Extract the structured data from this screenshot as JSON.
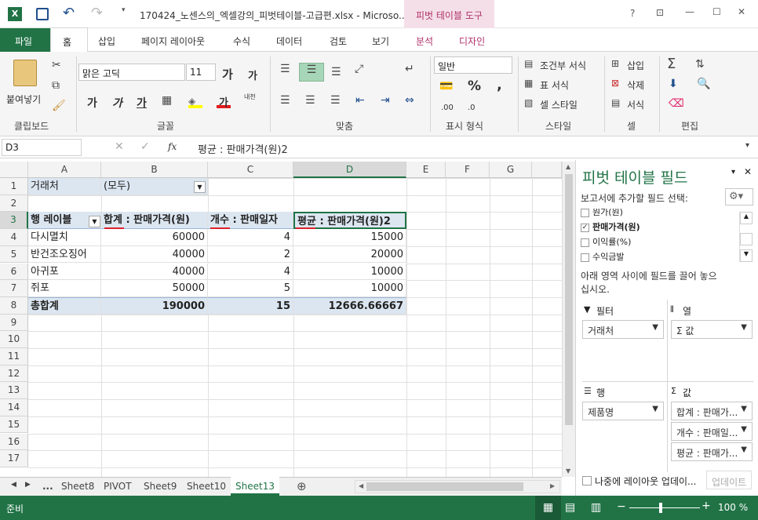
{
  "title": "170424_노센스의_엑셀강의_피벗테이블-고급편.xlsx - Microso...",
  "pivot_tools": "피벗 테이블 도구",
  "window_buttons": {
    "help": "?",
    "restore_ribbon": "⊡",
    "min": "—",
    "max": "☐",
    "close": "✕"
  },
  "tabs": [
    "파일",
    "홈",
    "삽입",
    "페이지 레이아웃",
    "수식",
    "데이터",
    "검토",
    "보기",
    "분석",
    "디자인"
  ],
  "ribbon": {
    "paste": "붙여넣기",
    "clipboard": "클립보드",
    "font_name": "맑은 고딕",
    "font_size": "11",
    "font_group": "글꼴",
    "align_group": "맞춤",
    "number_format": "일반",
    "number_group": "표시 형식",
    "cond_format": "조건부 서식",
    "table_format": "표 서식",
    "cell_style": "셀 스타일",
    "style_group": "스타일",
    "insert": "삽입",
    "delete": "삭제",
    "format": "서식",
    "cell_group": "셀",
    "edit_group": "편집",
    "font_buttons": [
      "가",
      "가",
      "가"
    ],
    "inc_font": "가",
    "dec_font": "가",
    "phonetic": "내천",
    "percent": "%",
    "comma": ",",
    "dec_inc": ".00",
    "dec_dec": ".0"
  },
  "formula_bar": {
    "name_box": "D3",
    "formula": "평균 : 판매가격(원)2",
    "fx": "fx"
  },
  "columns": [
    "A",
    "B",
    "C",
    "D",
    "E",
    "F",
    "G"
  ],
  "rows": [
    "1",
    "2",
    "3",
    "4",
    "5",
    "6",
    "7",
    "8",
    "9",
    "10",
    "11",
    "12",
    "13",
    "14",
    "15",
    "16",
    "17"
  ],
  "filter_row": {
    "label": "거래처",
    "value": "(모두)"
  },
  "headers": {
    "a": "행 레이블",
    "b": "합계 : 판매가격(원)",
    "c": "개수 : 판매일자",
    "d": "평균 : 판매가격(원)2"
  },
  "data_rows": [
    {
      "a": "다시멸치",
      "b": "60000",
      "c": "4",
      "d": "15000"
    },
    {
      "a": "반건조오징어",
      "b": "40000",
      "c": "2",
      "d": "20000"
    },
    {
      "a": "아귀포",
      "b": "40000",
      "c": "4",
      "d": "10000"
    },
    {
      "a": "쥐포",
      "b": "50000",
      "c": "5",
      "d": "10000"
    }
  ],
  "total_row": {
    "a": "총합계",
    "b": "190000",
    "c": "15",
    "d": "12666.66667"
  },
  "sheets": [
    "...",
    "Sheet8",
    "PIVOT",
    "Sheet9",
    "Sheet10",
    "Sheet13"
  ],
  "status": {
    "ready": "준비",
    "zoom": "100 %"
  },
  "pane": {
    "title": "피벗 테이블 필드",
    "subtitle": "보고서에 추가할 필드 선택:",
    "fields": [
      {
        "label": "원가(원)",
        "checked": false
      },
      {
        "label": "판매가격(원)",
        "checked": true
      },
      {
        "label": "이익률(%)",
        "checked": false
      },
      {
        "label": "수익금발",
        "checked": false
      }
    ],
    "drag_hint": "아래 영역 사이에 필드를 끌어 놓으십시오.",
    "filter_label": "필터",
    "column_label": "열",
    "row_label": "행",
    "value_label": "값",
    "filter_item": "거래처",
    "column_item": "Σ 값",
    "row_item": "제품명",
    "value_items": [
      "합계 : 판매가...",
      "개수 : 판매일...",
      "평균 : 판매가..."
    ],
    "defer": "나중에 레이아웃 업데이...",
    "update": "업데이트"
  }
}
